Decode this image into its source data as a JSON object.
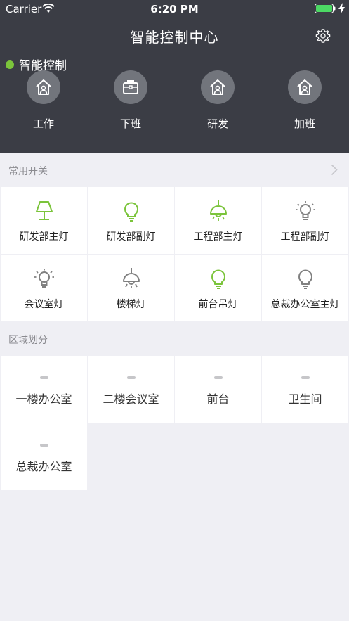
{
  "status_bar": {
    "carrier": "Carrier",
    "time": "6:20 PM"
  },
  "header": {
    "title": "智能控制中心"
  },
  "section_indicator": {
    "label": "智能控制",
    "color": "#7bc43b"
  },
  "modes": [
    {
      "label": "工作",
      "icon": "home-icon"
    },
    {
      "label": "下班",
      "icon": "briefcase-icon"
    },
    {
      "label": "研发",
      "icon": "home-person-icon"
    },
    {
      "label": "加班",
      "icon": "home-person-icon"
    }
  ],
  "switches": {
    "title": "常用开关",
    "items": [
      {
        "label": "研发部主灯",
        "icon": "table-lamp-icon",
        "on": true
      },
      {
        "label": "研发部副灯",
        "icon": "bulb-icon",
        "on": true
      },
      {
        "label": "工程部主灯",
        "icon": "pendant-lamp-icon",
        "on": true
      },
      {
        "label": "工程部副灯",
        "icon": "bulb-rays-icon",
        "on": false
      },
      {
        "label": "会议室灯",
        "icon": "bulb-rays-icon",
        "on": false
      },
      {
        "label": "楼梯灯",
        "icon": "pendant-lamp-icon",
        "on": false
      },
      {
        "label": "前台吊灯",
        "icon": "bulb-icon",
        "on": true
      },
      {
        "label": "总裁办公室主灯",
        "icon": "bulb-icon",
        "on": false
      }
    ]
  },
  "zones": {
    "title": "区域划分",
    "items": [
      {
        "label": "一楼办公室"
      },
      {
        "label": "二楼会议室"
      },
      {
        "label": "前台"
      },
      {
        "label": "卫生间"
      },
      {
        "label": "总裁办公室"
      }
    ]
  },
  "colors": {
    "header_bg": "#3b3d45",
    "accent": "#7bc43b",
    "off": "#808080"
  }
}
